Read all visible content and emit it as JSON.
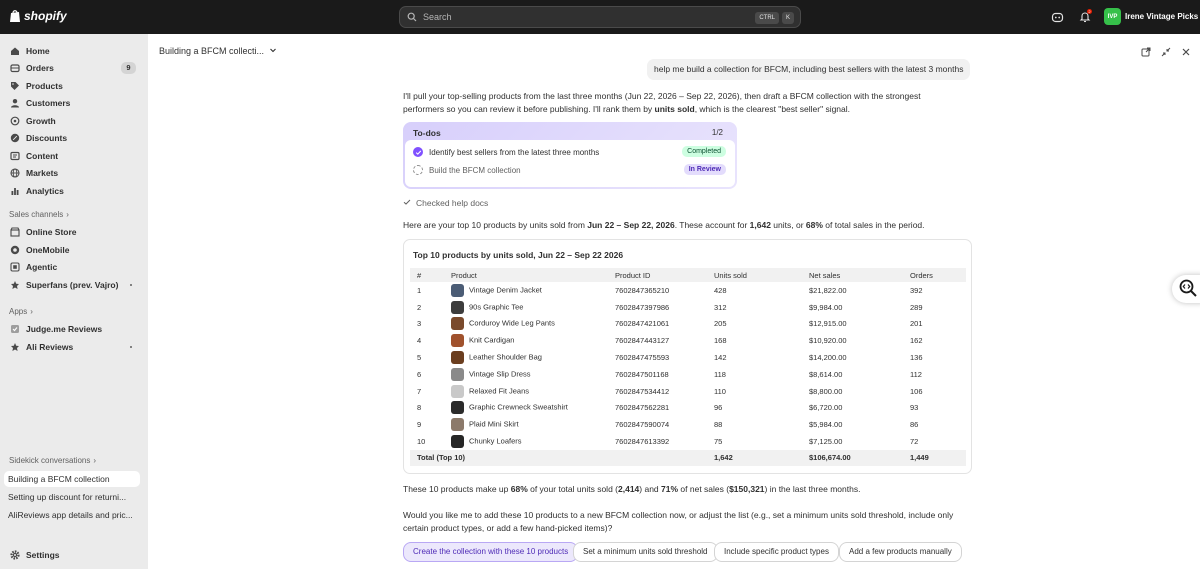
{
  "app": {
    "brand": "shopify",
    "accent": "#8051ff"
  },
  "topbar": {
    "search_placeholder": "Search",
    "shortcut_ctrl": "CTRL",
    "shortcut_key": "K",
    "notification_count": "2",
    "store_initials": "IVP",
    "store_name": "Irene Vintage Picks"
  },
  "sidebar": {
    "items": [
      {
        "label": "Home",
        "icon": "home-icon"
      },
      {
        "label": "Orders",
        "icon": "orders-icon",
        "count": "9"
      },
      {
        "label": "Products",
        "icon": "tag-icon"
      },
      {
        "label": "Customers",
        "icon": "person-icon"
      },
      {
        "label": "Growth",
        "icon": "growth-icon"
      },
      {
        "label": "Discounts",
        "icon": "discount-icon"
      },
      {
        "label": "Content",
        "icon": "content-icon"
      },
      {
        "label": "Markets",
        "icon": "globe-icon"
      },
      {
        "label": "Analytics",
        "icon": "bar-chart-icon"
      }
    ],
    "sales_channels_label": "Sales channels",
    "sales_channels": [
      {
        "label": "Online Store",
        "icon": "store-icon"
      },
      {
        "label": "OneMobile",
        "icon": "app-icon"
      },
      {
        "label": "Agentic",
        "icon": "agentic-icon"
      },
      {
        "label": "Superfans (prev. Vajro)",
        "icon": "superfans-icon"
      }
    ],
    "apps_label": "Apps",
    "apps": [
      {
        "label": "Judge.me Reviews",
        "icon": "judgeme-icon"
      },
      {
        "label": "Ali Reviews",
        "icon": "alireviews-icon"
      }
    ],
    "sidekick_label": "Sidekick conversations",
    "conversations": [
      "Building a BFCM collection",
      "Setting up discount for returni...",
      "AliReviews app details and pric..."
    ],
    "settings_label": "Settings"
  },
  "chat": {
    "title": "Building a BFCM collecti...",
    "user_message": "help me build a collection for BFCM, including best sellers with the latest 3 months",
    "intro_1": "I'll pull your top-selling products from the last three months (Jun 22, 2026 – Sep 22, 2026), then draft a BFCM collection with the strongest",
    "intro_2a": "performers so you can review it before publishing. I'll rank them by ",
    "intro_2b": "units sold",
    "intro_2c": ", which is the clearest \"best seller\" signal.",
    "todo": {
      "title": "To-dos",
      "count": "1/2",
      "items": [
        {
          "label": "Identify best sellers from the latest three months",
          "status": "Completed"
        },
        {
          "label": "Build the BFCM collection",
          "status": "In Review"
        }
      ]
    },
    "checked_docs": "Checked help docs",
    "summary_a": "Here are your top 10 products by units sold from ",
    "summary_b": "Jun 22 – Sep 22, 2026",
    "summary_c": ". These account for ",
    "summary_d": "1,642",
    "summary_e": " units, or ",
    "summary_f": "68%",
    "summary_g": " of total sales in the period.",
    "table": {
      "title": "Top 10 products by units sold, Jun 22 – Sep 22 2026",
      "columns": [
        "#",
        "Product",
        "Product ID",
        "Units sold",
        "Net sales",
        "Orders"
      ],
      "rows": [
        {
          "n": "1",
          "product": "Vintage Denim Jacket",
          "id": "7602847365210",
          "units": "428",
          "sales": "$21,822.00",
          "orders": "392",
          "thumb": "#4b5c75"
        },
        {
          "n": "2",
          "product": "90s Graphic Tee",
          "id": "7602847397986",
          "units": "312",
          "sales": "$9,984.00",
          "orders": "289",
          "thumb": "#3d3d3d"
        },
        {
          "n": "3",
          "product": "Corduroy Wide Leg Pants",
          "id": "7602847421061",
          "units": "205",
          "sales": "$12,915.00",
          "orders": "201",
          "thumb": "#7a4a2c"
        },
        {
          "n": "4",
          "product": "Knit Cardigan",
          "id": "7602847443127",
          "units": "168",
          "sales": "$10,920.00",
          "orders": "162",
          "thumb": "#a0522d"
        },
        {
          "n": "5",
          "product": "Leather Shoulder Bag",
          "id": "7602847475593",
          "units": "142",
          "sales": "$14,200.00",
          "orders": "136",
          "thumb": "#6b3e1f"
        },
        {
          "n": "6",
          "product": "Vintage Slip Dress",
          "id": "7602847501168",
          "units": "118",
          "sales": "$8,614.00",
          "orders": "112",
          "thumb": "#8a8a8a"
        },
        {
          "n": "7",
          "product": "Relaxed Fit Jeans",
          "id": "7602847534412",
          "units": "110",
          "sales": "$8,800.00",
          "orders": "106",
          "thumb": "#c9c9c9"
        },
        {
          "n": "8",
          "product": "Graphic Crewneck Sweatshirt",
          "id": "7602847562281",
          "units": "96",
          "sales": "$6,720.00",
          "orders": "93",
          "thumb": "#2b2b2b"
        },
        {
          "n": "9",
          "product": "Plaid Mini Skirt",
          "id": "7602847590074",
          "units": "88",
          "sales": "$5,984.00",
          "orders": "86",
          "thumb": "#8c7a6b"
        },
        {
          "n": "10",
          "product": "Chunky Loafers",
          "id": "7602847613392",
          "units": "75",
          "sales": "$7,125.00",
          "orders": "72",
          "thumb": "#262626"
        }
      ],
      "total": {
        "label": "Total (Top 10)",
        "units": "1,642",
        "sales": "$106,674.00",
        "orders": "1,449"
      }
    },
    "share_a": "These 10 products make up ",
    "share_b": "68%",
    "share_c": " of your total units sold (",
    "share_d": "2,414",
    "share_e": ") and ",
    "share_f": "71%",
    "share_g": " of net sales (",
    "share_h": "$150,321",
    "share_i": ") in the last three months.",
    "question_1": "Would you like me to add these 10 products to a new BFCM collection now, or adjust the list (e.g., set a minimum units sold threshold, include only",
    "question_2": "certain product types, or add a few hand-picked items)?",
    "suggestions": [
      "Create the collection with these 10 products",
      "Set a minimum units sold threshold",
      "Include specific product types",
      "Add a few products manually"
    ]
  }
}
